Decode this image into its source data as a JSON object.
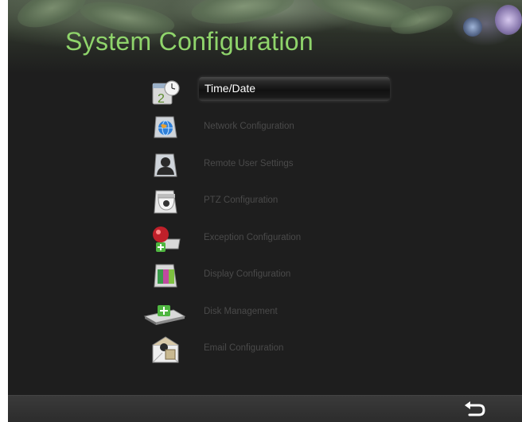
{
  "header": {
    "title": "System Configuration"
  },
  "menu": {
    "selected_index": 0,
    "items": [
      {
        "label": "Time/Date",
        "icon": "calendar-clock-icon"
      },
      {
        "label": "Network Configuration",
        "icon": "globe-network-icon"
      },
      {
        "label": "Remote User Settings",
        "icon": "user-silhouette-icon"
      },
      {
        "label": "PTZ Configuration",
        "icon": "dome-camera-icon"
      },
      {
        "label": "Exception Configuration",
        "icon": "alarm-light-icon"
      },
      {
        "label": "Display Configuration",
        "icon": "color-display-icon"
      },
      {
        "label": "Disk Management",
        "icon": "hard-disk-icon"
      },
      {
        "label": "Email Configuration",
        "icon": "envelope-icon"
      }
    ]
  },
  "footer": {
    "back_icon": "return-arrow-icon"
  },
  "colors": {
    "title": "#8fd46b",
    "selected_text": "#ffffff",
    "item_text": "#4a4a4a",
    "background": "#1e1e1e"
  }
}
